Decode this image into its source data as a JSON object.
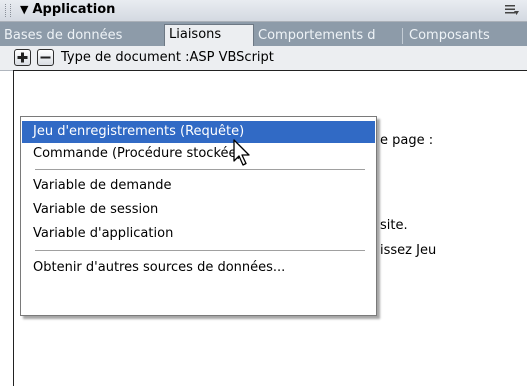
{
  "panel": {
    "title": "Application",
    "collapse_glyph": "▼",
    "options_icon": "panel-options-icon"
  },
  "tabs": [
    {
      "label": "Bases de données",
      "active": false
    },
    {
      "label": "Liaisons",
      "active": true
    },
    {
      "label": "Comportements d",
      "active": false
    },
    {
      "label": "Composants",
      "active": false
    }
  ],
  "toolbar": {
    "add_icon": "plus-icon",
    "remove_icon": "minus-icon",
    "document_type": "Type de document :ASP VBScript"
  },
  "background_text": {
    "page_fragment": "e page :",
    "site_fragment": "site.",
    "jeu_fragment": "issez Jeu"
  },
  "menu": {
    "items": [
      "Jeu d'enregistrements (Requête)",
      "Commande (Procédure stockée)",
      "Variable de demande",
      "Variable de session",
      "Variable d'application",
      "Obtenir d'autres sources de données..."
    ],
    "highlighted_index": 0
  },
  "colors": {
    "highlight": "#316ac5",
    "tabbar": "#8d9ba9",
    "titlebar": "#dde1e7"
  }
}
